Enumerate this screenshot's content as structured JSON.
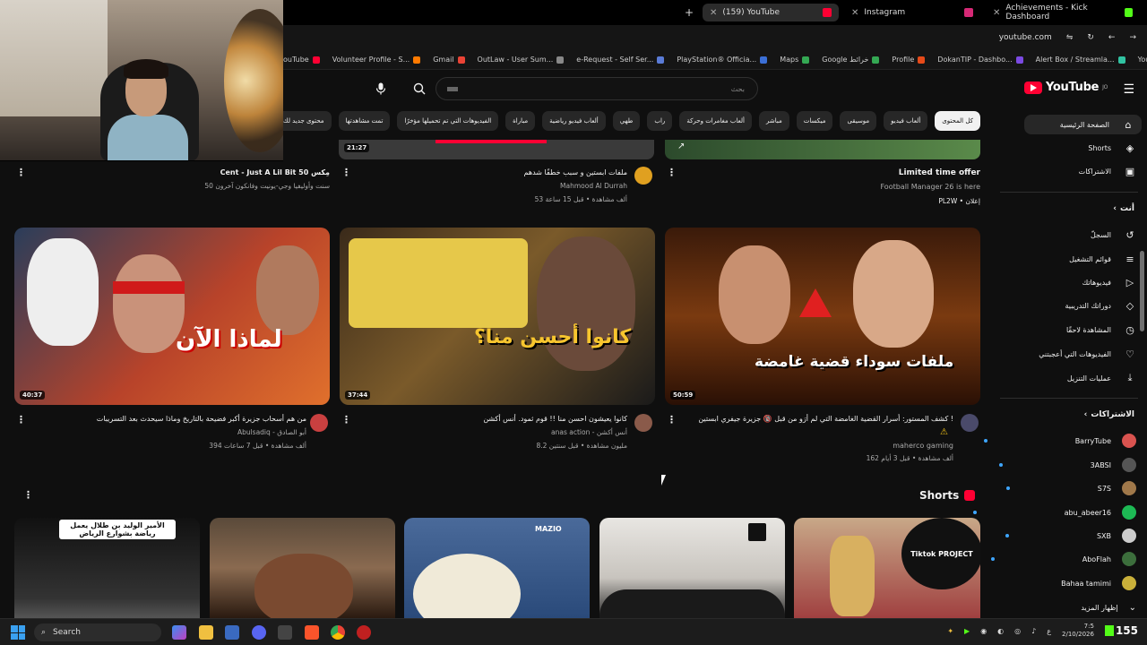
{
  "browser": {
    "tabs": [
      {
        "label": "(159) YouTube",
        "active": true,
        "fav": "#ff0033"
      },
      {
        "label": "Instagram",
        "active": false,
        "fav": "#d62976"
      },
      {
        "label": "Achievements - Kick Dashboard",
        "active": false,
        "fav": "#53fc18"
      }
    ],
    "new_tab": "+",
    "url": "youtube.com",
    "bookmarks": [
      {
        "label": "ouTube",
        "color": "#ff0033"
      },
      {
        "label": "Volunteer Profile - S...",
        "color": "#ff7a00"
      },
      {
        "label": "Gmail",
        "color": "#ea4335"
      },
      {
        "label": "OutLaw - User Sum...",
        "color": "#888888"
      },
      {
        "label": "e-Request - Self Ser...",
        "color": "#5a7bd6"
      },
      {
        "label": "PlayStation® Officia...",
        "color": "#3b6fd6"
      },
      {
        "label": "Maps",
        "color": "#34a853"
      },
      {
        "label": "Google خرائط",
        "color": "#34a853"
      },
      {
        "label": "Profile",
        "color": "#e64a19"
      },
      {
        "label": "DokanTIP - Dashbo...",
        "color": "#7b4ae2"
      },
      {
        "label": "Alert Box / Streamla...",
        "color": "#31c3a2"
      },
      {
        "label": "YouTube",
        "color": "#ff0033"
      }
    ]
  },
  "yt": {
    "logo": "YouTube",
    "logo_sup": "JO",
    "search_placeholder": "بحث",
    "chips": [
      "كل المحتوى",
      "ألعاب فيديو",
      "موسيقى",
      "ميكسات",
      "مباشر",
      "ألعاب مغامرات وحركة",
      "راب",
      "طهي",
      "ألعاب فيديو رياضية",
      "مباراة",
      "الفيديوهات التي تم تحميلها مؤخرًا",
      "تمت مشاهدتها",
      "محتوى جديد لك"
    ],
    "sidebar": {
      "main": [
        {
          "label": "الصفحة الرئيسية",
          "icon": "home-icon",
          "glyph": "⌂",
          "active": true
        },
        {
          "label": "Shorts",
          "icon": "shorts-icon",
          "glyph": "◈",
          "active": false
        },
        {
          "label": "الاشتراكات",
          "icon": "subscriptions-icon",
          "glyph": "▣",
          "active": false
        }
      ],
      "you_header": "أنت",
      "you": [
        {
          "label": "السجلّ",
          "icon": "history-icon",
          "glyph": "↺"
        },
        {
          "label": "قوائم التشغيل",
          "icon": "playlists-icon",
          "glyph": "≡"
        },
        {
          "label": "فيديوهاتك",
          "icon": "your-videos-icon",
          "glyph": "▷"
        },
        {
          "label": "دوراتك التدريبية",
          "icon": "courses-icon",
          "glyph": "◇"
        },
        {
          "label": "المشاهدة لاحقًا",
          "icon": "watch-later-icon",
          "glyph": "◷"
        },
        {
          "label": "الفيديوهات التي أعجبتني",
          "icon": "liked-icon",
          "glyph": "👍"
        },
        {
          "label": "عمليات التنزيل",
          "icon": "download-icon",
          "glyph": "⤓"
        }
      ],
      "subs_header": "الاشتراكات",
      "subs": [
        {
          "label": "BarryTube",
          "color": "#d9534f"
        },
        {
          "label": "3ABSI",
          "color": "#555555"
        },
        {
          "label": "S7S",
          "color": "#a0784a"
        },
        {
          "label": "abu_abeer16",
          "color": "#1db954"
        },
        {
          "label": "SXB",
          "color": "#cccccc"
        },
        {
          "label": "AboFlah",
          "color": "#3c6e3c"
        },
        {
          "label": "Bahaa tamimi",
          "color": "#c9b03a"
        }
      ],
      "show_more": "إظهار المزيد"
    },
    "top_row": [
      {
        "title": "Cent - Just A Lil Bit 50 مِكس",
        "meta": "50 سنت وأوليفيا وجي-يونيت وفانكون آخرون",
        "meta2": "",
        "duration": "21:27"
      },
      {
        "title": "ملفات ابستين و سبب خطفًا شدهم",
        "meta": "Mahmood Al Durrah",
        "meta2": "53 ألف مشاهدة • قبل 15 ساعة",
        "duration": ""
      },
      {
        "title": "Limited time offer",
        "meta": "Football Manager 26 is here",
        "meta2": "PL2W • إعلان",
        "duration": ""
      }
    ],
    "videos": [
      {
        "title": "من هم أسحاب جزيرة أكبر فضيحة بالتاريخ وماذا سيحدث بعد التسريبات",
        "channel": "Abulsadiq - أبو الصادق",
        "meta": "394 ألف مشاهدة • قبل 7 ساعات",
        "duration": "40:37",
        "thumb_text": "لماذا الآن"
      },
      {
        "title": "كانوا يعيشون احسن منا !! قوم ثمود. أنس أكشن",
        "channel": "anas action - أنس أكشن",
        "meta": "8.2 مليون مشاهدة • قبل سنتين",
        "duration": "37:44",
        "thumb_text": "كانوا أحسن منا؟"
      },
      {
        "title": "كشف المستور: أسرار القضية الغامضة التي لم أرَو من قبل 🔞 جزيرة جيفري ابستين !",
        "channel": "maherco gaming",
        "meta": "162 ألف مشاهدة • قبل 3 أيام",
        "duration": "50:59",
        "thumb_text": "ملفات سوداء قضية غامضة"
      }
    ],
    "shorts_label": "Shorts",
    "shorts": [
      {
        "caption": "الأمير الوليد بن طلال يعمل رياضة بشوارع الرياض"
      },
      {
        "caption": ""
      },
      {
        "caption": "MAZIO"
      },
      {
        "caption": ""
      },
      {
        "caption": "Tiktok PROJECT"
      }
    ]
  },
  "taskbar": {
    "search": "Search",
    "time": "7:5",
    "date": "2/10/2026",
    "kick_count": "155"
  }
}
